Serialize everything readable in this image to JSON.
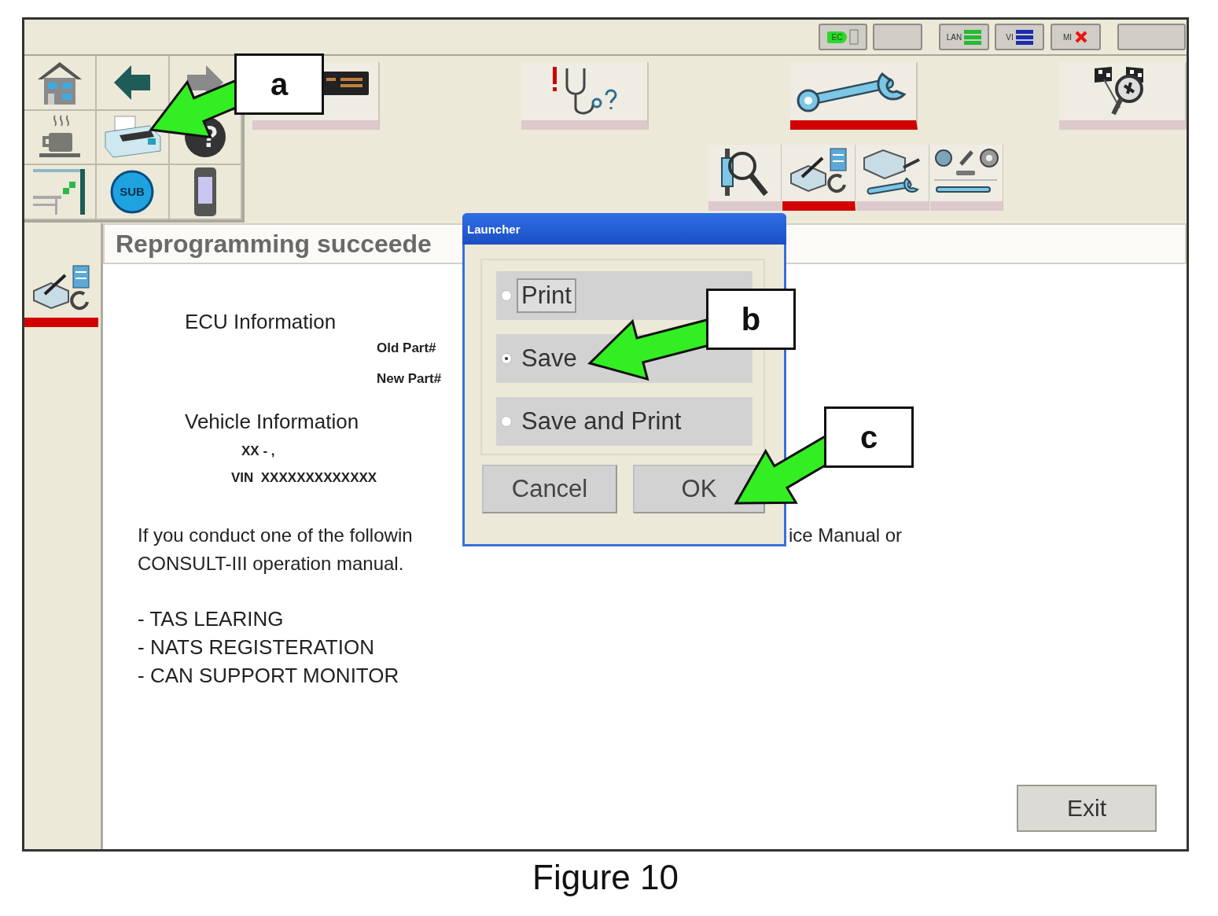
{
  "status_indicators": [
    {
      "kind": "plug",
      "label": "EC"
    },
    {
      "kind": "blank"
    },
    {
      "kind": "bars",
      "label": "LAN",
      "color": "#22bb33"
    },
    {
      "kind": "bars",
      "label": "VI",
      "color": "#1a2cb0"
    },
    {
      "kind": "error",
      "label": "MI"
    },
    {
      "kind": "blank"
    }
  ],
  "quick_grid": [
    {
      "kind": "home"
    },
    {
      "kind": "back"
    },
    {
      "kind": "forward"
    },
    {
      "kind": "coffee"
    },
    {
      "kind": "printer"
    },
    {
      "kind": "help",
      "glyph": "?"
    },
    {
      "kind": "layout"
    },
    {
      "kind": "sub",
      "label": "SUB"
    },
    {
      "kind": "handheld"
    }
  ],
  "toolbar": [
    {
      "kind": "display",
      "selected": false
    },
    {
      "kind": "diagnosis",
      "selected": false
    },
    {
      "kind": "wrench",
      "selected": true
    },
    {
      "kind": "flags",
      "selected": false
    }
  ],
  "sub_toolbar": [
    {
      "kind": "inspect",
      "selected": false
    },
    {
      "kind": "reprogram",
      "selected": true
    },
    {
      "kind": "ecu_wrench",
      "selected": false
    },
    {
      "kind": "parts",
      "selected": false
    }
  ],
  "sidebar": [
    {
      "kind": "reprogram",
      "selected": true
    }
  ],
  "title": "Reprogramming succeede",
  "ecu_heading": "ECU Information",
  "old_part": "Old Part#",
  "new_part": "New Part#",
  "vehicle_heading": "Vehicle Information",
  "vehicle_model": "XX - ,",
  "vin": "VIN  XXXXXXXXXXXXX",
  "notice": {
    "line_1_left": "If you conduct one of the followin",
    "line_1_right": "ice Manual or",
    "line_2": "CONSULT-III operation manual."
  },
  "operations": [
    "- TAS LEARING",
    "- NATS REGISTERATION",
    "- CAN SUPPORT MONITOR"
  ],
  "exit_button": "Exit",
  "dialog": {
    "title": "Launcher",
    "options": [
      {
        "label": "Print",
        "selected": false,
        "focused": true
      },
      {
        "label": "Save",
        "selected": true,
        "focused": false
      },
      {
        "label": "Save and Print",
        "selected": false,
        "focused": false
      }
    ],
    "buttons": [
      "Cancel",
      "OK"
    ]
  },
  "callouts": [
    {
      "label": "a"
    },
    {
      "label": "b"
    },
    {
      "label": "c"
    }
  ],
  "caption": "Figure 10"
}
